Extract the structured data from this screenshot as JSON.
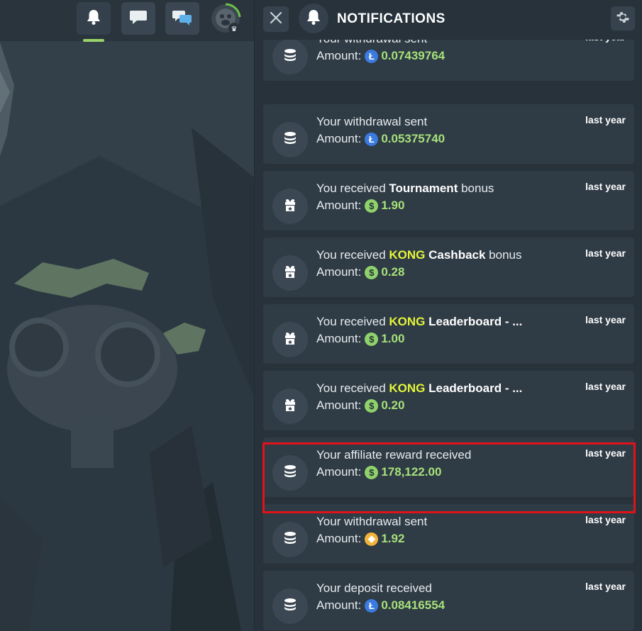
{
  "top_nav": {
    "buttons": [
      {
        "name": "notifications-bell-button",
        "icon": "bell-icon",
        "active": true
      },
      {
        "name": "chat-button",
        "icon": "chat-bubble-icon"
      },
      {
        "name": "messages-button",
        "icon": "chat-bubbles-icon"
      },
      {
        "name": "profile-avatar-button",
        "icon": "gorilla-avatar-icon"
      }
    ],
    "accent_color": "#9ad36a"
  },
  "panel": {
    "title": "NOTIFICATIONS",
    "close_icon": "close-icon",
    "settings_icon": "gear-icon"
  },
  "notifications": [
    {
      "icon": "coins-icon",
      "title_parts": [
        {
          "t": "Your withdrawal sent",
          "s": "n"
        }
      ],
      "amount_label": "Amount:",
      "coin": "ltc",
      "amount": "0.07439764",
      "time": "last year"
    },
    {
      "icon": "coins-icon",
      "title_parts": [
        {
          "t": "Your withdrawal sent",
          "s": "n"
        }
      ],
      "amount_label": "Amount:",
      "coin": "ltc",
      "amount": "0.05375740",
      "time": "last year"
    },
    {
      "icon": "gift-icon",
      "title_parts": [
        {
          "t": "You received ",
          "s": "n"
        },
        {
          "t": "Tournament",
          "s": "b"
        },
        {
          "t": " bonus",
          "s": "n"
        }
      ],
      "amount_label": "Amount:",
      "coin": "usd",
      "amount": "1.90",
      "time": "last year"
    },
    {
      "icon": "gift-icon",
      "title_parts": [
        {
          "t": "You received ",
          "s": "n"
        },
        {
          "t": "KONG",
          "s": "k"
        },
        {
          "t": " ",
          "s": "n"
        },
        {
          "t": "Cashback",
          "s": "b"
        },
        {
          "t": " bonus",
          "s": "n"
        }
      ],
      "amount_label": "Amount:",
      "coin": "usd",
      "amount": "0.28",
      "time": "last year"
    },
    {
      "icon": "gift-icon",
      "title_parts": [
        {
          "t": "You received ",
          "s": "n"
        },
        {
          "t": "KONG",
          "s": "k"
        },
        {
          "t": " ",
          "s": "n"
        },
        {
          "t": "Leaderboard - ...",
          "s": "b"
        }
      ],
      "amount_label": "Amount:",
      "coin": "usd",
      "amount": "1.00",
      "time": "last year"
    },
    {
      "icon": "gift-icon",
      "title_parts": [
        {
          "t": "You received ",
          "s": "n"
        },
        {
          "t": "KONG",
          "s": "k"
        },
        {
          "t": " ",
          "s": "n"
        },
        {
          "t": "Leaderboard - ...",
          "s": "b"
        }
      ],
      "amount_label": "Amount:",
      "coin": "usd",
      "amount": "0.20",
      "time": "last year"
    },
    {
      "icon": "coins-icon",
      "title_parts": [
        {
          "t": "Your affiliate reward received",
          "s": "n"
        }
      ],
      "amount_label": "Amount:",
      "coin": "usd",
      "amount": "178,122.00",
      "time": "last year",
      "highlighted": true
    },
    {
      "icon": "coins-icon",
      "title_parts": [
        {
          "t": "Your withdrawal sent",
          "s": "n"
        }
      ],
      "amount_label": "Amount:",
      "coin": "bnb",
      "amount": "1.92",
      "time": "last year"
    },
    {
      "icon": "coins-icon",
      "title_parts": [
        {
          "t": "Your deposit received",
          "s": "n"
        }
      ],
      "amount_label": "Amount:",
      "coin": "ltc",
      "amount": "0.08416554",
      "time": "last year"
    }
  ],
  "colors": {
    "highlight_border": "#e3121a",
    "kong_yellow": "#e4f53a",
    "amount_green": "#a6e07a"
  }
}
